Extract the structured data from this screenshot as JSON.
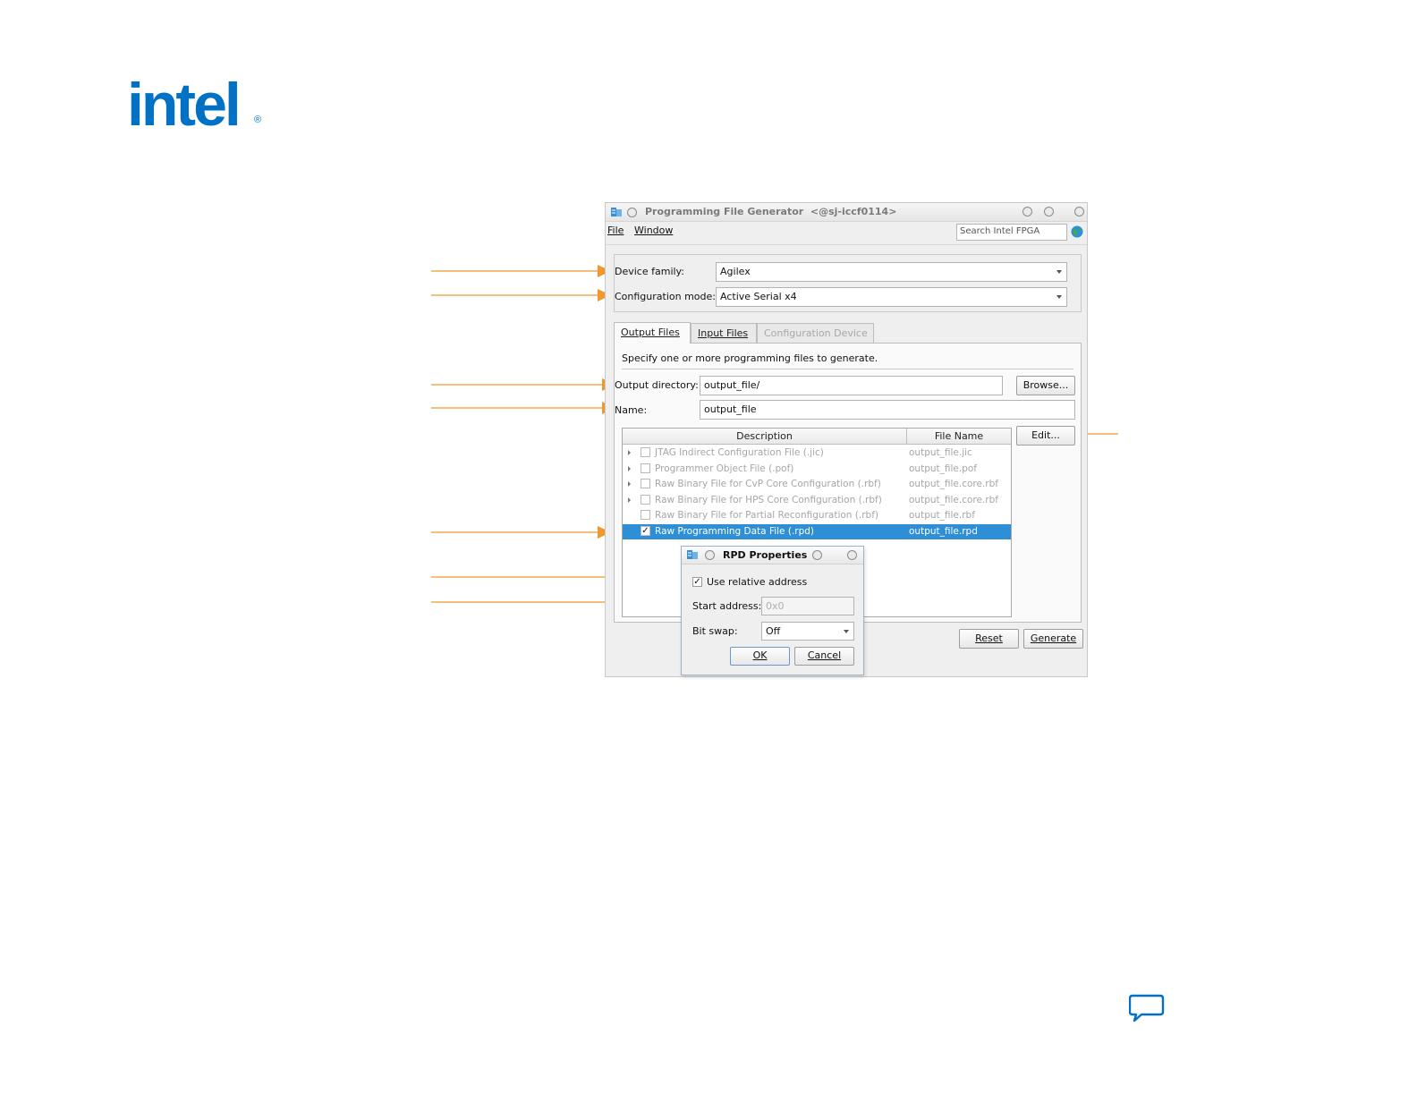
{
  "brand": {
    "logo_text": "intel",
    "logo_registered": "®",
    "brand_color": "#0071c5",
    "accent_color": "#f0982f"
  },
  "window": {
    "title": "Programming File Generator",
    "host": "<@sj-iccf0114>",
    "menu": [
      "File",
      "Window"
    ],
    "search_placeholder": "Search Intel FPGA"
  },
  "device": {
    "family_label": "Device family:",
    "family_value": "Agilex",
    "mode_label": "Configuration mode:",
    "mode_value": "Active Serial x4"
  },
  "tabs": [
    {
      "label": "Output Files",
      "state": "active"
    },
    {
      "label": "Input Files",
      "state": "normal"
    },
    {
      "label": "Configuration Device",
      "state": "disabled"
    }
  ],
  "output": {
    "hint": "Specify one or more programming files to generate.",
    "dir_label": "Output directory:",
    "dir_value": "output_file/",
    "browse": "Browse...",
    "name_label": "Name:",
    "name_value": "output_file",
    "edit": "Edit..."
  },
  "table": {
    "columns": [
      "Description",
      "File Name"
    ],
    "rows": [
      {
        "description": "JTAG Indirect Configuration File (.jic)",
        "file": "output_file.jic",
        "checked": false,
        "expandable": true
      },
      {
        "description": "Programmer Object File (.pof)",
        "file": "output_file.pof",
        "checked": false,
        "expandable": true
      },
      {
        "description": "Raw Binary File for CvP Core Configuration (.rbf)",
        "file": "output_file.core.rbf",
        "checked": false,
        "expandable": true
      },
      {
        "description": "Raw Binary File for HPS Core Configuration (.rbf)",
        "file": "output_file.core.rbf",
        "checked": false,
        "expandable": true
      },
      {
        "description": "Raw Binary File for Partial Reconfiguration (.rbf)",
        "file": "output_file.rbf",
        "checked": false,
        "expandable": false
      },
      {
        "description": "Raw Programming Data File (.rpd)",
        "file": "output_file.rpd",
        "checked": true,
        "expandable": false
      }
    ]
  },
  "buttons": {
    "reset": "Reset",
    "generate": "Generate"
  },
  "rpd_dialog": {
    "title": "RPD Properties",
    "use_relative": "Use relative address",
    "use_relative_checked": true,
    "start_label": "Start address:",
    "start_value": "0x0",
    "bitswap_label": "Bit swap:",
    "bitswap_value": "Off",
    "ok": "OK",
    "cancel": "Cancel"
  }
}
